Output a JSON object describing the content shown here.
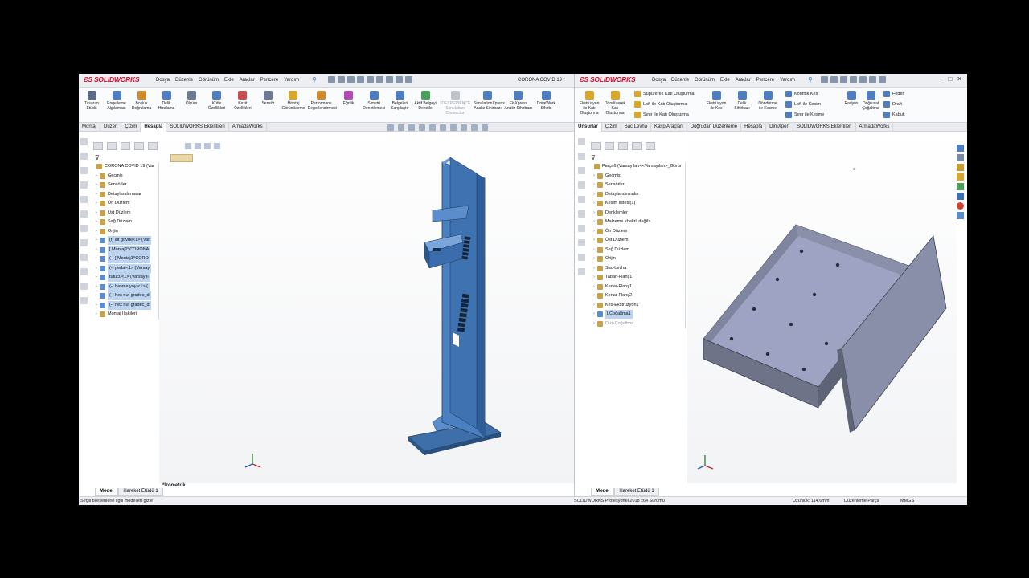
{
  "colors": {
    "part_blue": "#4a7fbf",
    "part_gray": "#9ea0b0",
    "brand_red": "#c8102e",
    "selection": "#bcd4f0"
  },
  "left": {
    "logo": "SOLIDWORKS",
    "menus": [
      "Dosya",
      "Düzenle",
      "Görünüm",
      "Ekle",
      "Araçlar",
      "Pencere",
      "Yardım"
    ],
    "doc_title": "CORONA COVID 19 *",
    "ribbon": [
      {
        "label1": "Tasarım",
        "label2": "Etüdü",
        "color": "#5a6b85"
      },
      {
        "label1": "Engelleme",
        "label2": "Algılaması",
        "color": "#4e7dc1"
      },
      {
        "label1": "Boşluk",
        "label2": "Doğrulama",
        "color": "#cf8a2b"
      },
      {
        "label1": "Delik",
        "label2": "Hizalama",
        "color": "#4e7dc1"
      },
      {
        "label1": "Ölçüm",
        "label2": "",
        "color": "#6a7b93"
      },
      {
        "label1": "Kütle",
        "label2": "Özellikleri",
        "color": "#4e7dc1"
      },
      {
        "label1": "Kesit",
        "label2": "Özellikleri",
        "color": "#c94d4d"
      },
      {
        "label1": "Sensör",
        "label2": "",
        "color": "#6a7b93"
      },
      {
        "label1": "Montaj",
        "label2": "Görüntüleme",
        "color": "#d9a62e"
      },
      {
        "label1": "Performans",
        "label2": "Değerlendirmesi",
        "color": "#cf8a2b"
      },
      {
        "label1": "Eğrilik",
        "label2": "",
        "color": "#b24bb6"
      },
      {
        "label1": "Simetri",
        "label2": "Denetlemesi",
        "color": "#4e7dc1"
      },
      {
        "label1": "Belgeleri",
        "label2": "Karşılaştır",
        "color": "#4e7dc1"
      },
      {
        "label1": "Aktif Belgeyi",
        "label2": "Denetle",
        "color": "#4aa05a"
      },
      {
        "label1": "3DEXPERIENCE",
        "label2": "Simulation Connector",
        "color": "#c0c4ca"
      },
      {
        "label1": "SimulationXpress",
        "label2": "Analiz Sihirbazı",
        "color": "#4e7dc1"
      },
      {
        "label1": "FloXpress",
        "label2": "Analiz Sihirbazı",
        "color": "#4e7dc1"
      },
      {
        "label1": "DriveWork",
        "label2": "Sihirbi",
        "color": "#4e7dc1"
      }
    ],
    "tabs": [
      "Montaj",
      "Düzen",
      "Çizim",
      "Hesapla",
      "SOLIDWORKS Eklentileri",
      "ArmadaWorks"
    ],
    "active_tab": "Hesapla",
    "tree": [
      {
        "label": "CORONA COVID 19  (Var",
        "level": 0,
        "sel": false
      },
      {
        "label": "Geçmiş",
        "level": 1,
        "sel": false
      },
      {
        "label": "Sensörler",
        "level": 1,
        "sel": false
      },
      {
        "label": "Detaylandırmalar",
        "level": 1,
        "sel": false
      },
      {
        "label": "Ön Düzlem",
        "level": 1,
        "sel": false
      },
      {
        "label": "Üst Düzlem",
        "level": 1,
        "sel": false
      },
      {
        "label": "Sağ Düzlem",
        "level": 1,
        "sel": false
      },
      {
        "label": "Orijin",
        "level": 1,
        "sel": false
      },
      {
        "label": "(f) alt govde<1> (Var",
        "level": 1,
        "sel": true
      },
      {
        "label": "[ Montaj2^CORONA",
        "level": 1,
        "sel": true
      },
      {
        "label": "(-) [ Montaj1^CORO",
        "level": 1,
        "sel": true
      },
      {
        "label": "(-) pedal<1> (Varsay",
        "level": 1,
        "sel": true
      },
      {
        "label": "tutucu<1> (Varsayılı",
        "level": 1,
        "sel": true
      },
      {
        "label": "(-) basma yayı<1> (",
        "level": 1,
        "sel": true
      },
      {
        "label": "(-) hex nut gradec_d",
        "level": 1,
        "sel": true
      },
      {
        "label": "(-) hex nut gradec_d",
        "level": 1,
        "sel": true
      },
      {
        "label": "Montaj İlişkileri",
        "level": 1,
        "sel": false
      }
    ],
    "bottom_tabs": [
      "Model",
      "Hareket Etüdü 1"
    ],
    "view_name": "*İzometrik"
  },
  "right": {
    "logo": "SOLIDWORKS",
    "menus": [
      "Dosya",
      "Düzenle",
      "Görünüm",
      "Ekle",
      "Araçlar",
      "Pencere",
      "Yardım"
    ],
    "ribbon_big": [
      {
        "label1": "Ekstrüzyon",
        "label2": "ile Katı Oluşturma",
        "color": "#d9a62e"
      },
      {
        "label1": "Döndürerek",
        "label2": "Katı Oluşturma",
        "color": "#d9a62e"
      },
      {
        "label1": "Ekstrüzyon",
        "label2": "ile Kes",
        "color": "#4e7dc1"
      },
      {
        "label1": "Delik",
        "label2": "Sihirbazı",
        "color": "#4e7dc1"
      },
      {
        "label1": "Döndürme",
        "label2": "ile Kesme",
        "color": "#4e7dc1"
      },
      {
        "label1": "Radyus",
        "label2": "",
        "color": "#4e7dc1"
      },
      {
        "label1": "Doğrusal",
        "label2": "Çoğaltma",
        "color": "#4e7dc1"
      }
    ],
    "ribbon_rows": [
      "Süpürerek Katı Oluşturma",
      "Loft ile Katı Oluşturma",
      "Sınır ile Katı Oluşturma",
      "Konmik Kes",
      "Loft ile Kesim",
      "Sınır ile Kesme",
      "Feder",
      "Draft",
      "Kabuk"
    ],
    "tabs": [
      "Unsurlar",
      "Çizim",
      "Sac Levha",
      "Kalıp Araçları",
      "Doğrudan Düzenleme",
      "Hesapla",
      "DimXpert",
      "SOLIDWORKS Eklentileri",
      "ArmadaWorks"
    ],
    "active_tab": "Unsurlar",
    "tree": [
      {
        "label": "Parça6  (Varsayılan<<Varsayılan>_Görür",
        "level": 0,
        "sel": false,
        "dim": false
      },
      {
        "label": "Geçmiş",
        "level": 1,
        "sel": false,
        "dim": false
      },
      {
        "label": "Sensörler",
        "level": 1,
        "sel": false,
        "dim": false
      },
      {
        "label": "Detaylandırmalar",
        "level": 1,
        "sel": false,
        "dim": false
      },
      {
        "label": "Kesim listesi(1)",
        "level": 1,
        "sel": false,
        "dim": false
      },
      {
        "label": "Denklemler",
        "level": 1,
        "sel": false,
        "dim": false
      },
      {
        "label": "Malzeme <belirli değil>",
        "level": 1,
        "sel": false,
        "dim": false
      },
      {
        "label": "Ön Düzlem",
        "level": 1,
        "sel": false,
        "dim": false
      },
      {
        "label": "Üst Düzlem",
        "level": 1,
        "sel": false,
        "dim": false
      },
      {
        "label": "Sağ Düzlem",
        "level": 1,
        "sel": false,
        "dim": false
      },
      {
        "label": "Orijin",
        "level": 1,
        "sel": false,
        "dim": false
      },
      {
        "label": "Sac-Levha",
        "level": 1,
        "sel": false,
        "dim": false
      },
      {
        "label": "Taban-Flanş1",
        "level": 1,
        "sel": false,
        "dim": false
      },
      {
        "label": "Kenar-Flanş1",
        "level": 1,
        "sel": false,
        "dim": false
      },
      {
        "label": "Kenar-Flanş2",
        "level": 1,
        "sel": false,
        "dim": false
      },
      {
        "label": "Kes-Ekstrüzyon1",
        "level": 1,
        "sel": false,
        "dim": false
      },
      {
        "label": "LÇoğaltma1",
        "level": 1,
        "sel": true,
        "dim": false
      },
      {
        "label": "Düz-Çoğaltma",
        "level": 1,
        "sel": false,
        "dim": true
      }
    ],
    "bottom_tabs": [
      "Model",
      "Hareket Etüdü 1"
    ]
  },
  "status": {
    "left_msg": "Seçili bileşenlerle ilgili modelleri gizle",
    "version": "SOLIDWORKS Profesyonel 2018 x64 Sürümü",
    "length": "Uzunluk: 114.6mm",
    "mode": "Düzenleme Parça",
    "units": "MMGS"
  }
}
